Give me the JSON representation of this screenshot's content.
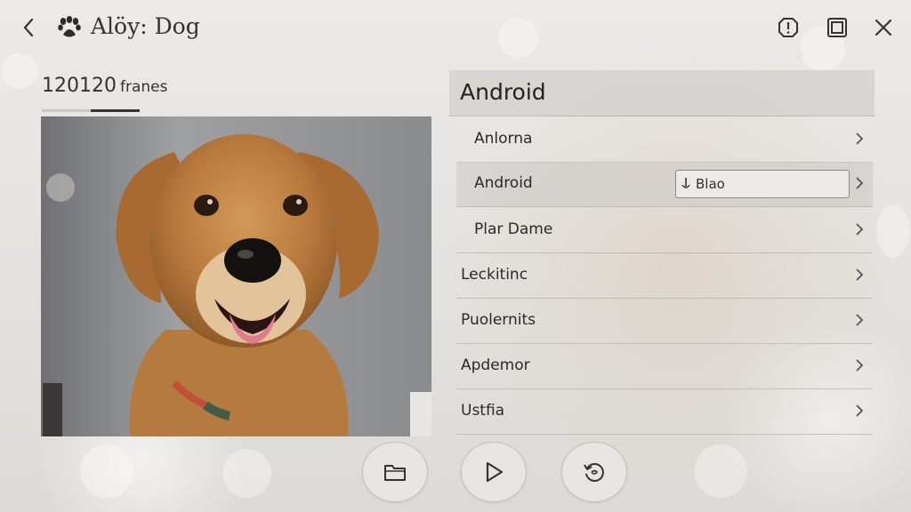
{
  "header": {
    "title": "Alöy: Dog",
    "back_icon": "chevron-left-icon",
    "app_icon": "paw-icon",
    "actions": [
      {
        "name": "info-icon"
      },
      {
        "name": "window-icon"
      },
      {
        "name": "close-icon"
      }
    ]
  },
  "frames": {
    "count": "120120",
    "unit": "franes",
    "progress": 0.5
  },
  "panel": {
    "title": "Android",
    "items": [
      {
        "label": "Anlorna"
      },
      {
        "label": "Android",
        "selected": true,
        "field_value": "Blao"
      },
      {
        "label": "Plar Dame"
      },
      {
        "label": "Leckitinc"
      },
      {
        "label": "Puolernits"
      },
      {
        "label": "Apdemor"
      },
      {
        "label": "Ustfia"
      }
    ]
  },
  "controls": [
    {
      "name": "folder-icon"
    },
    {
      "name": "play-icon"
    },
    {
      "name": "replay-icon"
    }
  ],
  "colors": {
    "background": "#e6e4e1",
    "text": "#2a2a2a",
    "accent_dark": "#333333"
  }
}
